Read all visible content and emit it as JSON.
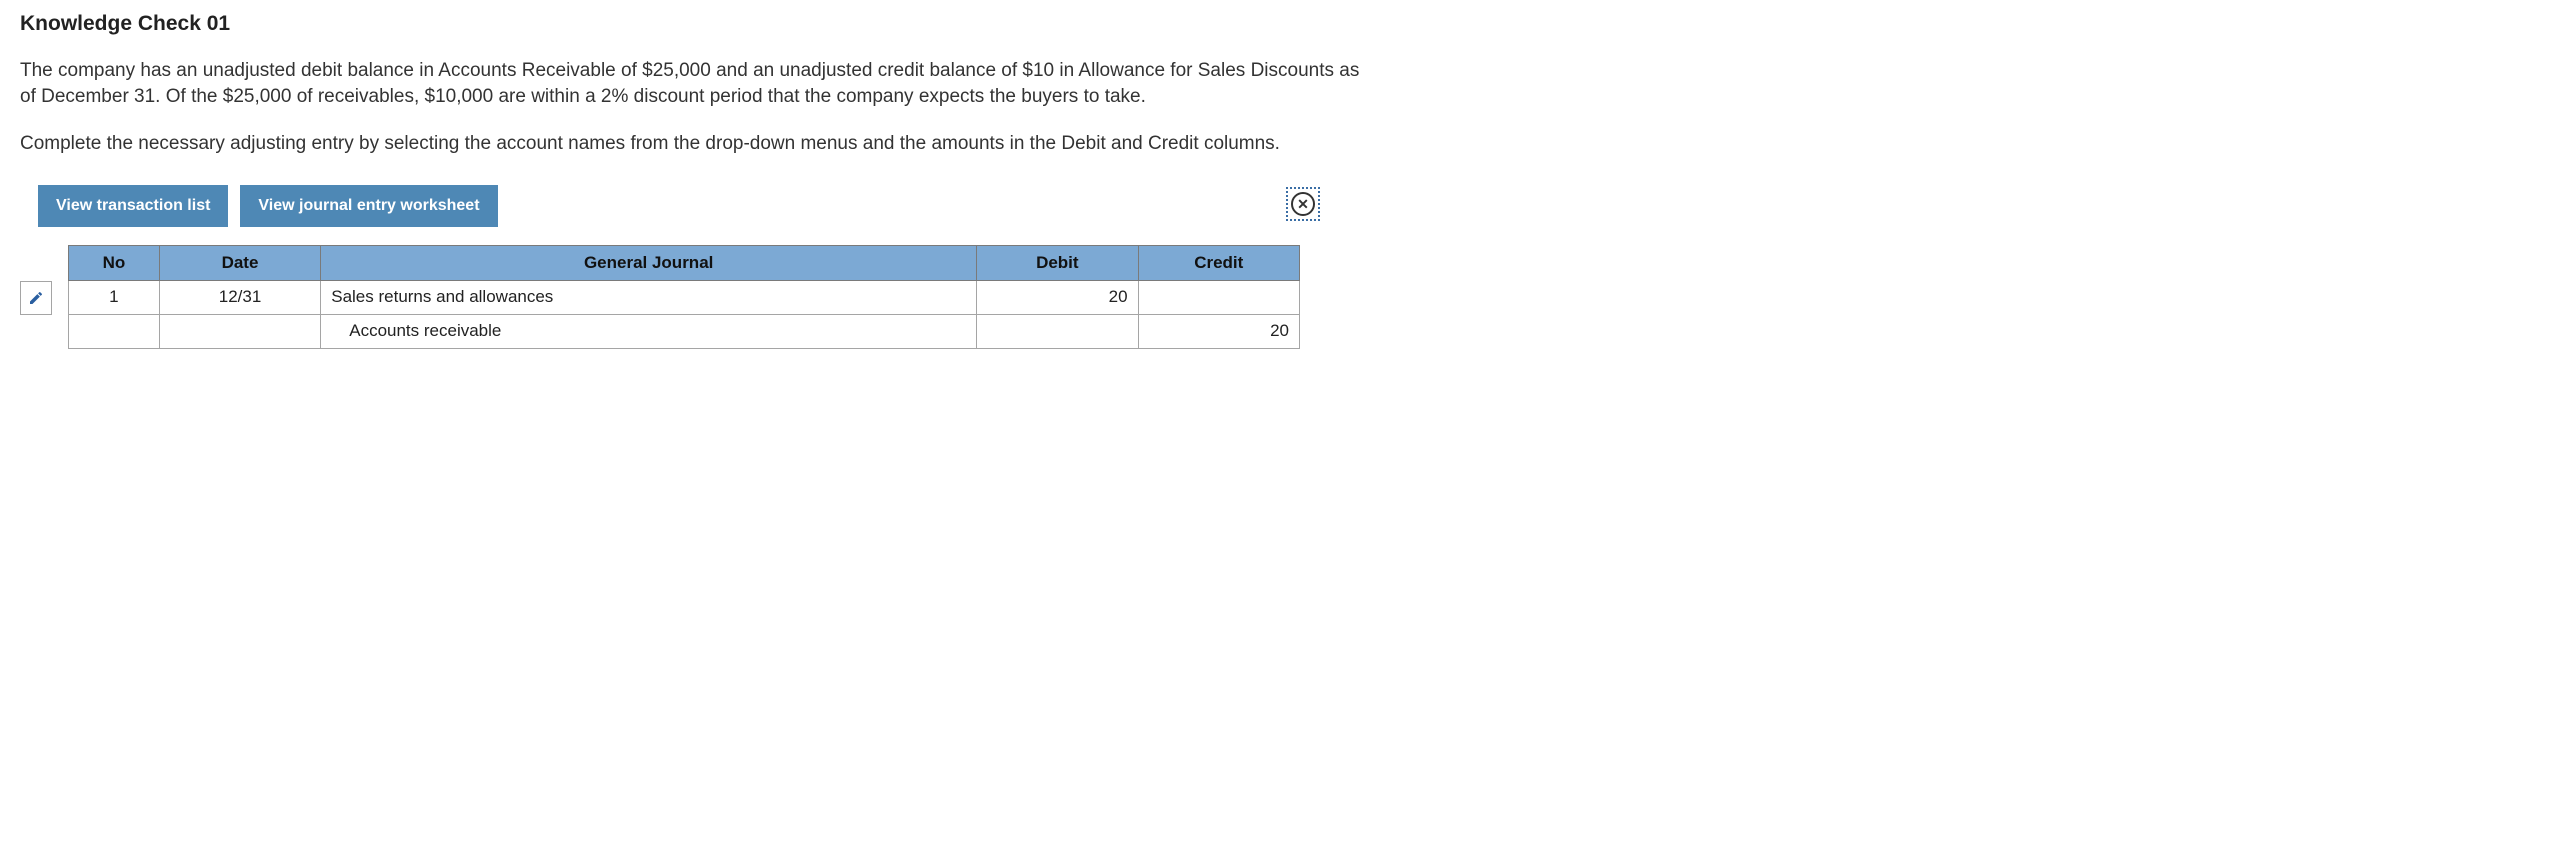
{
  "title": "Knowledge Check 01",
  "paragraph1": "The company has an unadjusted debit balance in Accounts Receivable of $25,000 and an unadjusted credit balance of $10 in Allowance for Sales Discounts as of December 31. Of the $25,000 of receivables, $10,000 are within a 2% discount period that the company expects the buyers to take.",
  "paragraph2": "Complete the necessary adjusting entry by selecting the account names from the drop-down menus and the amounts in the Debit and Credit columns.",
  "buttons": {
    "view_transaction_list": "View transaction list",
    "view_journal_worksheet": "View journal entry worksheet"
  },
  "table": {
    "headers": {
      "no": "No",
      "date": "Date",
      "general_journal": "General Journal",
      "debit": "Debit",
      "credit": "Credit"
    },
    "rows": [
      {
        "no": "1",
        "date": "12/31",
        "account": "Sales returns and allowances",
        "debit": "20",
        "credit": "",
        "indent": false
      },
      {
        "no": "",
        "date": "",
        "account": "Accounts receivable",
        "debit": "",
        "credit": "20",
        "indent": true
      }
    ]
  }
}
